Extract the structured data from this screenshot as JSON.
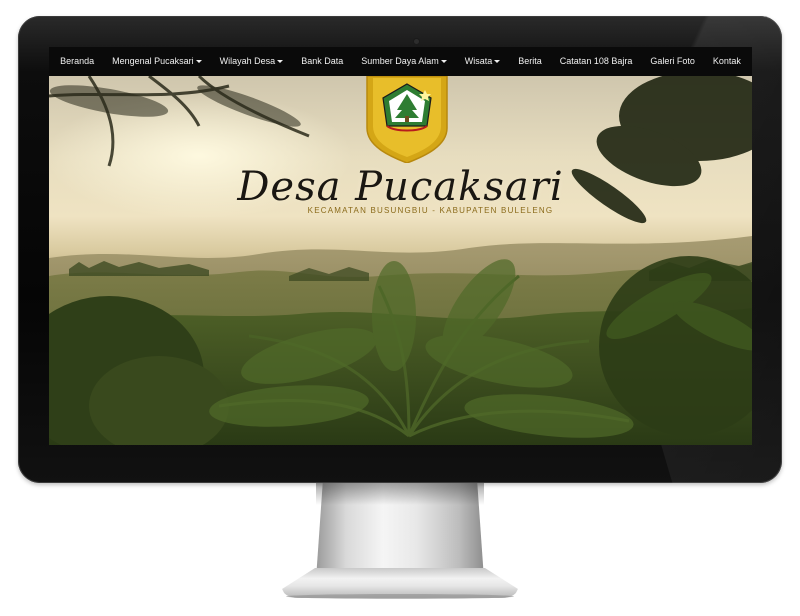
{
  "navbar": {
    "items": [
      {
        "label": "Beranda",
        "dropdown": false
      },
      {
        "label": "Mengenal Pucaksari",
        "dropdown": true
      },
      {
        "label": "Wilayah Desa",
        "dropdown": true
      },
      {
        "label": "Bank Data",
        "dropdown": false
      },
      {
        "label": "Sumber Daya Alam",
        "dropdown": true
      },
      {
        "label": "Wisata",
        "dropdown": true
      },
      {
        "label": "Berita",
        "dropdown": false
      },
      {
        "label": "Catatan 108 Bajra",
        "dropdown": false
      },
      {
        "label": "Galeri Foto",
        "dropdown": false
      },
      {
        "label": "Kontak",
        "dropdown": false
      }
    ]
  },
  "hero": {
    "title": "Desa Pucaksari",
    "subtitle": "KECAMATAN BUSUNGBIU - KABUPATEN BULELENG"
  },
  "colors": {
    "navbar_bg": "#0a0a0a",
    "emblem_gold": "#e3b21c",
    "subtitle_gold": "#8a6a1a",
    "bezel": "#0d0d0d"
  },
  "icons": {
    "emblem": "village-coat-of-arms",
    "caret": "caret-down-icon"
  }
}
